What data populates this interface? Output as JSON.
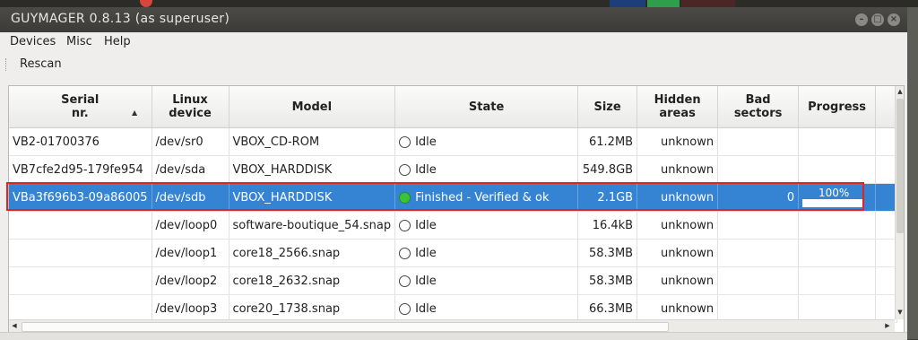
{
  "window": {
    "title": "GUYMAGER 0.8.13 (as superuser)"
  },
  "menu": {
    "devices": "Devices",
    "misc": "Misc",
    "help": "Help"
  },
  "toolbar": {
    "rescan": "Rescan"
  },
  "columns": {
    "serial": "Serial\nnr.",
    "linux_device": "Linux\ndevice",
    "model": "Model",
    "state": "State",
    "size": "Size",
    "hidden_areas": "Hidden\nareas",
    "bad_sectors": "Bad\nsectors",
    "progress": "Progress"
  },
  "rows": [
    {
      "serial": "VB2-01700376",
      "device": "/dev/sr0",
      "model": "VBOX_CD-ROM",
      "state": "Idle",
      "state_icon": "idle-circle-icon",
      "size": "61.2MB",
      "hidden": "unknown",
      "bad": "",
      "progress": ""
    },
    {
      "serial": "VB7cfe2d95-179fe954",
      "device": "/dev/sda",
      "model": "VBOX_HARDDISK",
      "state": "Idle",
      "state_icon": "idle-circle-icon",
      "size": "549.8GB",
      "hidden": "unknown",
      "bad": "",
      "progress": ""
    },
    {
      "serial": "VBa3f696b3-09a86005",
      "device": "/dev/sdb",
      "model": "VBOX_HARDDISK",
      "state": "Finished - Verified & ok",
      "state_icon": "green-circle-icon",
      "size": "2.1GB",
      "hidden": "unknown",
      "bad": "0",
      "progress": "100%",
      "progress_value": 1.0
    },
    {
      "serial": "",
      "device": "/dev/loop0",
      "model": "software-boutique_54.snap",
      "state": "Idle",
      "state_icon": "idle-circle-icon",
      "size": "16.4kB",
      "hidden": "unknown",
      "bad": "",
      "progress": ""
    },
    {
      "serial": "",
      "device": "/dev/loop1",
      "model": "core18_2566.snap",
      "state": "Idle",
      "state_icon": "idle-circle-icon",
      "size": "58.3MB",
      "hidden": "unknown",
      "bad": "",
      "progress": ""
    },
    {
      "serial": "",
      "device": "/dev/loop2",
      "model": "core18_2632.snap",
      "state": "Idle",
      "state_icon": "idle-circle-icon",
      "size": "58.3MB",
      "hidden": "unknown",
      "bad": "",
      "progress": ""
    },
    {
      "serial": "",
      "device": "/dev/loop3",
      "model": "core20_1738.snap",
      "state": "Idle",
      "state_icon": "idle-circle-icon",
      "size": "66.3MB",
      "hidden": "unknown",
      "bad": "",
      "progress": ""
    }
  ],
  "colors": {
    "selection": "#3584d4",
    "highlight_border": "#e02424",
    "finished_green": "#3ac23a",
    "titlebar": "#3c3b37"
  }
}
